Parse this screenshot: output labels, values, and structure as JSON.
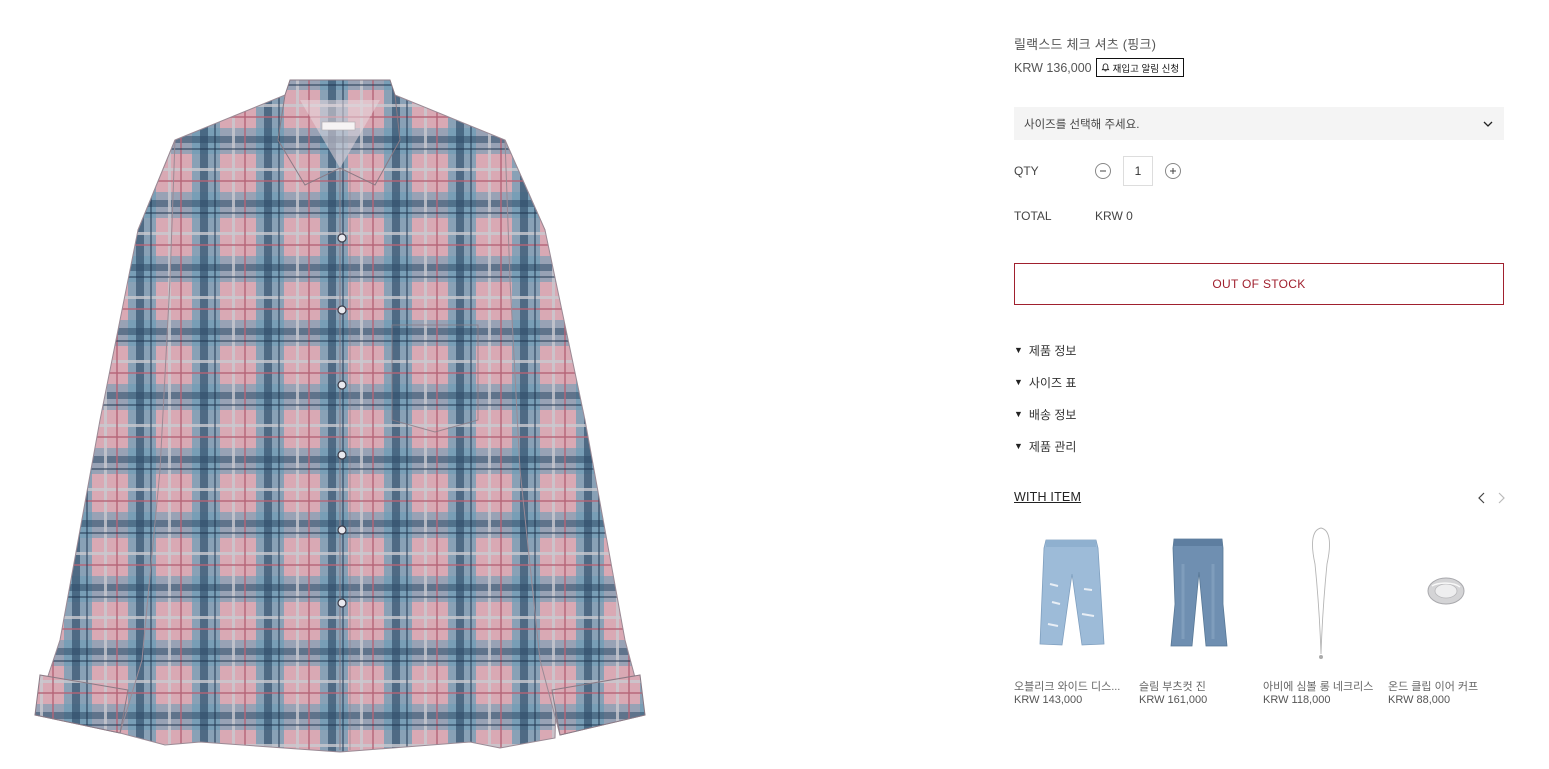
{
  "product": {
    "title": "릴랙스드 체크 셔츠 (핑크)",
    "price": "KRW 136,000",
    "restock_label": "재입고 알림 신청",
    "image_icon": "plaid-shirt-image"
  },
  "options": {
    "size_placeholder": "사이즈를 선택해 주세요."
  },
  "quantity": {
    "label": "QTY",
    "value": "1"
  },
  "total": {
    "label": "TOTAL",
    "value": "KRW 0"
  },
  "cta": {
    "out_of_stock_label": "OUT OF STOCK",
    "accent_color": "#a0202e"
  },
  "accordion": [
    {
      "label": "제품 정보"
    },
    {
      "label": "사이즈 표"
    },
    {
      "label": "배송 정보"
    },
    {
      "label": "제품 관리"
    }
  ],
  "with_item": {
    "title": "WITH ITEM",
    "items": [
      {
        "name": "오블리크 와이드 디스...",
        "price": "KRW 143,000",
        "icon": "distressed-wide-jeans-image"
      },
      {
        "name": "슬림 부츠컷 진",
        "price": "KRW 161,000",
        "icon": "bootcut-jeans-image"
      },
      {
        "name": "아비에 심볼 롱 네크리스",
        "price": "KRW 118,000",
        "icon": "long-necklace-image"
      },
      {
        "name": "온드 클립 이어 커프",
        "price": "KRW 88,000",
        "icon": "ear-cuff-image"
      }
    ]
  }
}
